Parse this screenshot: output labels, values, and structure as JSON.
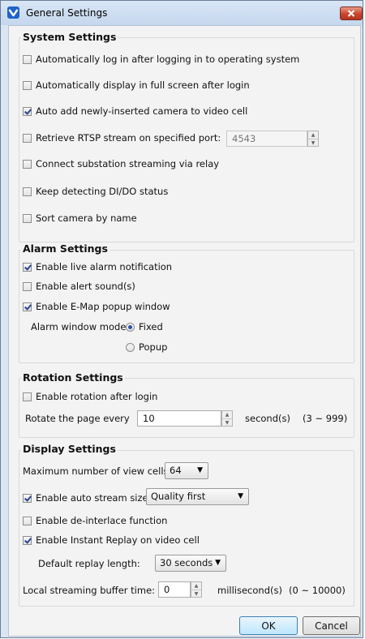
{
  "window": {
    "title": "General Settings",
    "close_icon": "close-x-icon",
    "app_icon": "app-logo-icon"
  },
  "system": {
    "title": "System Settings",
    "items": [
      {
        "label": "Automatically log in after logging in to operating system",
        "checked": false
      },
      {
        "label": "Automatically display in full screen after login",
        "checked": false
      },
      {
        "label": "Auto add newly-inserted camera to video cell",
        "checked": true
      },
      {
        "label": "Retrieve RTSP stream on specified port:",
        "checked": false
      },
      {
        "label": "Connect substation streaming via relay",
        "checked": false
      },
      {
        "label": "Keep detecting DI/DO status",
        "checked": false
      },
      {
        "label": "Sort camera by name",
        "checked": false
      }
    ],
    "rtsp_port": "4543"
  },
  "alarm": {
    "title": "Alarm Settings",
    "items": [
      {
        "label": "Enable live alarm notification",
        "checked": true
      },
      {
        "label": "Enable alert sound(s)",
        "checked": false
      },
      {
        "label": "Enable E-Map popup window",
        "checked": true
      }
    ],
    "mode_label": "Alarm window mode:",
    "modes": [
      {
        "label": "Fixed",
        "selected": true
      },
      {
        "label": "Popup",
        "selected": false
      }
    ]
  },
  "rotation": {
    "title": "Rotation Settings",
    "enable_label": "Enable rotation after login",
    "enable_checked": false,
    "rotate_label": "Rotate the page every",
    "rotate_value": "10",
    "unit": "second(s)",
    "range": "(3 ~ 999)"
  },
  "display": {
    "title": "Display Settings",
    "max_cells_label": "Maximum number of view cells",
    "max_cells_value": "64",
    "auto_stream_label": "Enable auto stream size:",
    "auto_stream_checked": true,
    "auto_stream_value": "Quality first",
    "deinterlace_label": "Enable de-interlace function",
    "deinterlace_checked": false,
    "instant_replay_label": "Enable Instant Replay on video cell",
    "instant_replay_checked": true,
    "replay_length_label": "Default replay length:",
    "replay_length_value": "30 seconds",
    "buffer_label": "Local streaming buffer time:",
    "buffer_value": "0",
    "buffer_unit": "millisecond(s)",
    "buffer_range": "(0 ~ 10000)"
  },
  "buttons": {
    "ok": "OK",
    "cancel": "Cancel"
  }
}
